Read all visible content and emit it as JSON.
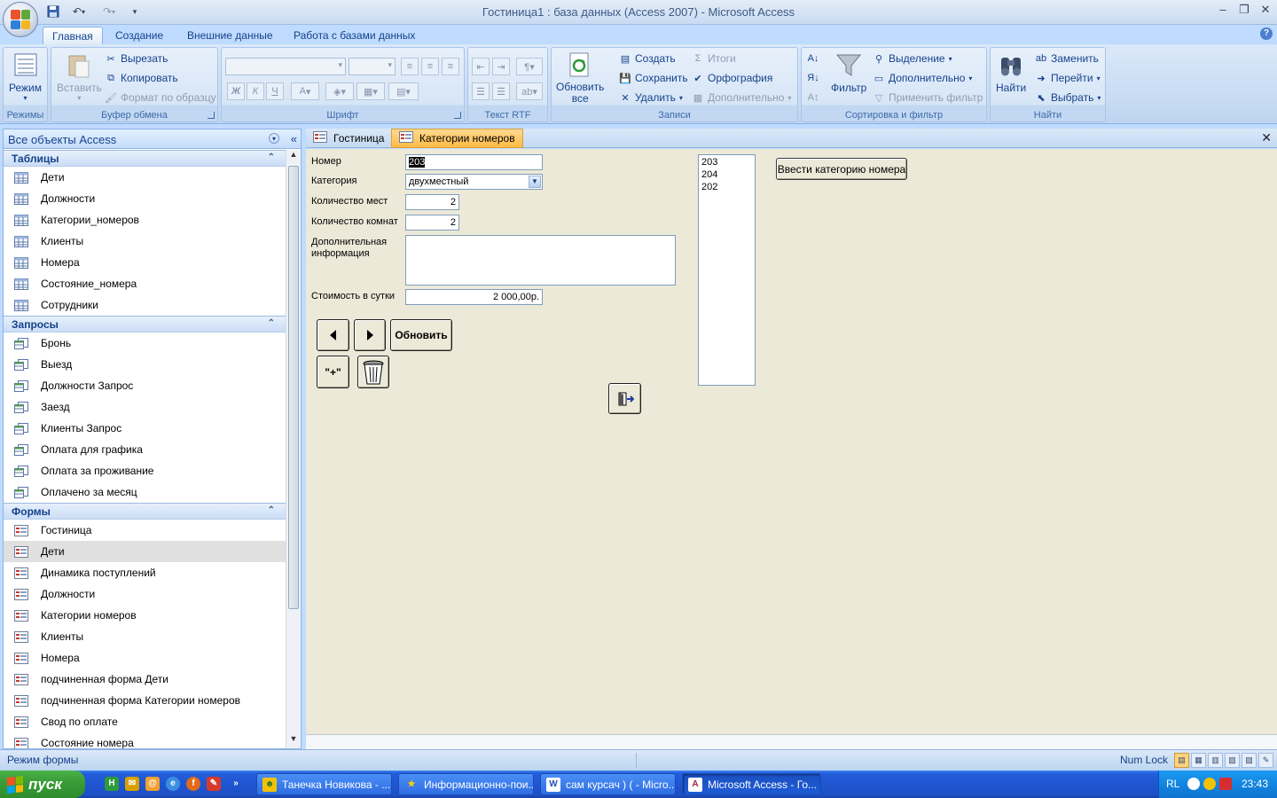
{
  "window": {
    "title": "Гостиница1 : база данных (Access 2007) - Microsoft Access",
    "controls": [
      "–",
      "❐",
      "✕"
    ]
  },
  "quick_access": [
    "save-icon",
    "undo-icon",
    "redo-icon",
    "customize-icon"
  ],
  "ribbon_tabs": [
    "Главная",
    "Создание",
    "Внешние данные",
    "Работа с базами данных"
  ],
  "ribbon": {
    "modes": {
      "title": "Режимы",
      "view_label": "Режим"
    },
    "clipboard": {
      "title": "Буфер обмена",
      "paste_label": "Вставить",
      "cut_label": "Вырезать",
      "copy_label": "Копировать",
      "format_painter_label": "Формат по образцу"
    },
    "font": {
      "title": "Шрифт",
      "bold": "Ж",
      "italic": "К",
      "underline": "Ч",
      "font_color": "A"
    },
    "rtf": {
      "title": "Текст RTF"
    },
    "records": {
      "title": "Записи",
      "refresh_label": "Обновить\nвсе",
      "new_label": "Создать",
      "save_label": "Сохранить",
      "delete_label": "Удалить",
      "totals_label": "Итоги",
      "spelling_label": "Орфография",
      "more_label": "Дополнительно"
    },
    "sort_filter": {
      "title": "Сортировка и фильтр",
      "filter_label": "Фильтр",
      "selection_label": "Выделение",
      "advanced_label": "Дополнительно",
      "toggle_filter_label": "Применить фильтр"
    },
    "find": {
      "title": "Найти",
      "find_label": "Найти",
      "replace_label": "Заменить",
      "goto_label": "Перейти",
      "select_label": "Выбрать"
    }
  },
  "nav": {
    "header": "Все объекты Access",
    "groups": [
      {
        "name": "Таблицы",
        "type": "table",
        "items": [
          "Дети",
          "Должности",
          "Категории_номеров",
          "Клиенты",
          "Номера",
          "Состояние_номера",
          "Сотрудники"
        ]
      },
      {
        "name": "Запросы",
        "type": "query",
        "items": [
          "Бронь",
          "Выезд",
          "Должности Запрос",
          "Заезд",
          "Клиенты Запрос",
          "Оплата для графика",
          "Оплата за проживание",
          "Оплачено за месяц"
        ]
      },
      {
        "name": "Формы",
        "type": "form",
        "items": [
          "Гостиница",
          "Дети",
          "Динамика поступлений",
          "Должности",
          "Категории номеров",
          "Клиенты",
          "Номера",
          "подчиненная форма Дети",
          "подчиненная форма Категории номеров",
          "Свод по оплате",
          "Состояние номера"
        ]
      }
    ],
    "selected_form_index": 1
  },
  "doc_tabs": [
    {
      "label": "Гостиница",
      "active": false
    },
    {
      "label": "Категории номеров",
      "active": true
    }
  ],
  "form": {
    "labels": {
      "number": "Номер",
      "category": "Категория",
      "seats": "Количество мест",
      "rooms": "Количество комнат",
      "extra_info": "Дополнительная информация",
      "price": "Стоимость в сутки"
    },
    "values": {
      "number": "203",
      "category": "двухместный",
      "seats": "2",
      "rooms": "2",
      "extra_info": "",
      "price": "2 000,00р."
    },
    "buttons": {
      "refresh": "Обновить",
      "add": "\"+\"",
      "enter_category": "Ввести категорию номера"
    },
    "listbox": [
      "203",
      "204",
      "202"
    ]
  },
  "statusbar": {
    "mode": "Режим формы",
    "numlock": "Num Lock"
  },
  "taskbar": {
    "start": "пуск",
    "windows": [
      {
        "label": "Танечка Новикова - ...",
        "active": false
      },
      {
        "label": "Информационно-пои...",
        "active": false
      },
      {
        "label": "сам курсач ) ( - Micro...",
        "active": false
      },
      {
        "label": "Microsoft Access - Го...",
        "active": true
      }
    ],
    "lang": "RL",
    "clock": "23:43"
  },
  "colors": {
    "ribbon_bg": "#bfdbff",
    "active_tab": "#ffbb45",
    "form_bg": "#ece9d8",
    "taskbar": "#245edb",
    "start": "#3a9c38"
  }
}
